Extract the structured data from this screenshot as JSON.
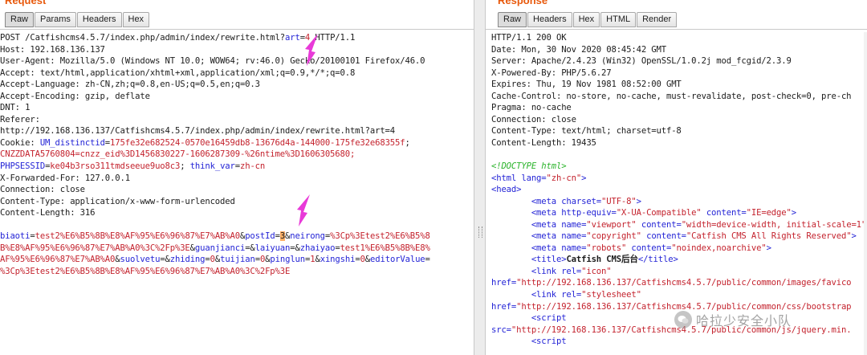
{
  "request": {
    "title": "Request",
    "tabs": [
      {
        "label": "Raw",
        "active": true
      },
      {
        "label": "Params"
      },
      {
        "label": "Headers"
      },
      {
        "label": "Hex"
      }
    ],
    "lines": [
      "POST /Catfishcms4.5.7/index.php/admin/index/rewrite.html?art=4 HTTP/1.1",
      "Host: 192.168.136.137",
      "User-Agent: Mozilla/5.0 (Windows NT 10.0; WOW64; rv:46.0) Gecko/20100101 Firefox/46.0",
      "Accept: text/html,application/xhtml+xml,application/xml;q=0.9,*/*;q=0.8",
      "Accept-Language: zh-CN,zh;q=0.8,en-US;q=0.5,en;q=0.3",
      "Accept-Encoding: gzip, deflate",
      "DNT: 1",
      "Referer:",
      "http://192.168.136.137/Catfishcms4.5.7/index.php/admin/index/rewrite.html?art=4",
      "Cookie: UM_distinctid=175fe32e682524-0570e16459db8-13676d4a-144000-175fe32e68355f;",
      "CNZZDATA5760804=cnzz_eid%3D1456830227-1606287309-%26ntime%3D1606305680;",
      "PHPSESSID=ke04b3rso311tmdseeue9uo8c3; think_var=zh-cn",
      "X-Forwarded-For: 127.0.0.1",
      "Connection: close",
      "Content-Type: application/x-www-form-urlencoded",
      "Content-Length: 316",
      "",
      "biaoti=test2%E6%B5%8B%E8%AF%95%E6%96%87%E7%AB%A0&postId=3&neirong=%3Cp%3Etest2%E6%B5%8",
      "B%E8%AF%95%E6%96%87%E7%AB%A0%3C%2Fp%3E&guanjianci=&laiyuan=&zhaiyao=test1%E6%B5%8B%E8%",
      "AF%95%E6%96%87%E7%AB%A0&suolvetu=&zhiding=0&tuijian=0&pinglun=1&xingshi=0&editorValue=",
      "%3Cp%3Etest2%E6%B5%8B%E8%AF%95%E6%96%87%E7%AB%A0%3C%2Fp%3E"
    ]
  },
  "response": {
    "title": "Response",
    "tabs": [
      {
        "label": "Raw",
        "active": true
      },
      {
        "label": "Headers"
      },
      {
        "label": "Hex"
      },
      {
        "label": "HTML"
      },
      {
        "label": "Render"
      }
    ],
    "lines": [
      "HTTP/1.1 200 OK",
      "Date: Mon, 30 Nov 2020 08:45:42 GMT",
      "Server: Apache/2.4.23 (Win32) OpenSSL/1.0.2j mod_fcgid/2.3.9",
      "X-Powered-By: PHP/5.6.27",
      "Expires: Thu, 19 Nov 1981 08:52:00 GMT",
      "Cache-Control: no-store, no-cache, must-revalidate, post-check=0, pre-ch",
      "Pragma: no-cache",
      "Connection: close",
      "Content-Type: text/html; charset=utf-8",
      "Content-Length: 19435",
      "",
      "<!DOCTYPE html>",
      "<html lang=\"zh-cn\">",
      "<head>",
      "        <meta charset=\"UTF-8\">",
      "        <meta http-equiv=\"X-UA-Compatible\" content=\"IE=edge\">",
      "        <meta name=\"viewport\" content=\"width=device-width, initial-scale=1\"",
      "        <meta name=\"copyright\" content=\"Catfish CMS All Rights Reserved\">",
      "        <meta name=\"robots\" content=\"noindex,noarchive\">",
      "        <title>Catfish CMS后台</title>",
      "        <link rel=\"icon\"",
      "href=\"http://192.168.136.137/Catfishcms4.5.7/public/common/images/favico",
      "        <link rel=\"stylesheet\"",
      "href=\"http://192.168.136.137/Catfishcms4.5.7/public/common/css/bootstrap",
      "        <script",
      "src=\"http://192.168.136.137/Catfishcms4.5.7/public/common/js/jquery.min.",
      "        <script"
    ]
  },
  "watermark": {
    "text": "哈拉少安全小队"
  },
  "colors": {
    "accent": "#e8590c",
    "arrow": "#e83ad8",
    "highlight": "#ffb066",
    "tag": "#2424d6",
    "value": "#c4232e"
  }
}
